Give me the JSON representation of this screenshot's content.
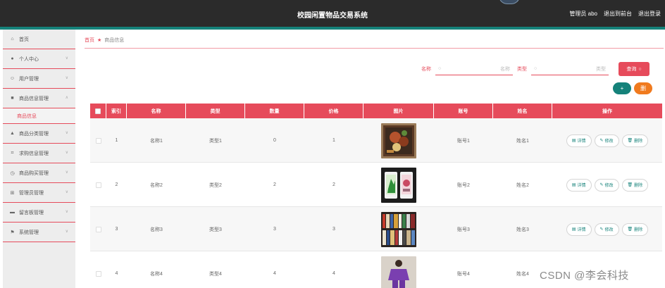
{
  "header": {
    "title": "校园闲置物品交易系统",
    "admin_label": "管理员 abo",
    "back_front_label": "退出到前台",
    "logout_label": "退出登录"
  },
  "sidebar": {
    "items": [
      {
        "label": "首页",
        "icon": "home-icon"
      },
      {
        "label": "个人中心",
        "icon": "person-icon"
      },
      {
        "label": "用户管理",
        "icon": "user-icon"
      },
      {
        "label": "商品信息管理",
        "icon": "grid-icon"
      },
      {
        "label": "商品分类管理",
        "icon": "shop-icon"
      },
      {
        "label": "求购信息管理",
        "icon": "crop-icon"
      },
      {
        "label": "商品购买管理",
        "icon": "clock-icon"
      },
      {
        "label": "管理员管理",
        "icon": "table-icon"
      },
      {
        "label": "留言板管理",
        "icon": "board-icon"
      },
      {
        "label": "系统管理",
        "icon": "flag-icon"
      }
    ],
    "sub_item": "商品信息"
  },
  "breadcrumb": {
    "home": "首页",
    "current": "商品信息"
  },
  "search": {
    "name_label": "名称",
    "name_placeholder": "名称",
    "type_label": "类型",
    "type_placeholder": "类型",
    "query_label": "查询"
  },
  "actions": {
    "add_label": "+",
    "delete_label": "删"
  },
  "table": {
    "columns": [
      "索引",
      "名称",
      "类型",
      "数量",
      "价格",
      "图片",
      "账号",
      "姓名",
      "操作"
    ],
    "rows": [
      {
        "index": "1",
        "name": "名称1",
        "type": "类型1",
        "quantity": "0",
        "price": "1",
        "account": "账号1",
        "person": "姓名1"
      },
      {
        "index": "2",
        "name": "名称2",
        "type": "类型2",
        "quantity": "2",
        "price": "2",
        "account": "账号2",
        "person": "姓名2"
      },
      {
        "index": "3",
        "name": "名称3",
        "type": "类型3",
        "quantity": "3",
        "price": "3",
        "account": "账号3",
        "person": "姓名3"
      },
      {
        "index": "4",
        "name": "名称4",
        "type": "类型4",
        "quantity": "4",
        "price": "4",
        "account": "账号4",
        "person": "姓名4"
      }
    ],
    "op_labels": {
      "detail": "详情",
      "edit": "修改",
      "delete": "删除"
    }
  },
  "watermark": "CSDN @李会科技",
  "colors": {
    "accent": "#e64b5b",
    "teal": "#15827a",
    "orange": "#f07a1e",
    "topbar": "#2b2b2b"
  }
}
